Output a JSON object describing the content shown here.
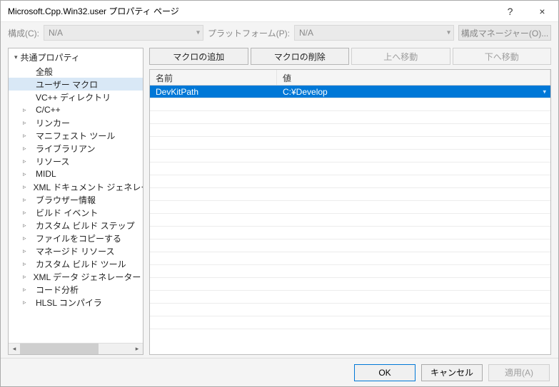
{
  "title": "Microsoft.Cpp.Win32.user プロパティ ページ",
  "titlebar": {
    "help": "?",
    "close": "×"
  },
  "config": {
    "cfg_label": "構成(C):",
    "cfg_value": "N/A",
    "plat_label": "プラットフォーム(P):",
    "plat_value": "N/A",
    "cfg_mgr": "構成マネージャー(O)..."
  },
  "tree": {
    "root": "共通プロパティ",
    "items": [
      {
        "label": "全般",
        "arrow": false,
        "selected": false
      },
      {
        "label": "ユーザー マクロ",
        "arrow": false,
        "selected": true
      },
      {
        "label": "VC++ ディレクトリ",
        "arrow": false,
        "selected": false
      },
      {
        "label": "C/C++",
        "arrow": true,
        "selected": false
      },
      {
        "label": "リンカー",
        "arrow": true,
        "selected": false
      },
      {
        "label": "マニフェスト ツール",
        "arrow": true,
        "selected": false
      },
      {
        "label": "ライブラリアン",
        "arrow": true,
        "selected": false
      },
      {
        "label": "リソース",
        "arrow": true,
        "selected": false
      },
      {
        "label": "MIDL",
        "arrow": true,
        "selected": false
      },
      {
        "label": "XML ドキュメント ジェネレーター",
        "arrow": true,
        "selected": false
      },
      {
        "label": "ブラウザー情報",
        "arrow": true,
        "selected": false
      },
      {
        "label": "ビルド イベント",
        "arrow": true,
        "selected": false
      },
      {
        "label": "カスタム ビルド ステップ",
        "arrow": true,
        "selected": false
      },
      {
        "label": "ファイルをコピーする",
        "arrow": true,
        "selected": false
      },
      {
        "label": "マネージド リソース",
        "arrow": true,
        "selected": false
      },
      {
        "label": "カスタム ビルド ツール",
        "arrow": true,
        "selected": false
      },
      {
        "label": "XML データ ジェネレーター ツ...",
        "arrow": true,
        "selected": false
      },
      {
        "label": "コード分析",
        "arrow": true,
        "selected": false
      },
      {
        "label": "HLSL コンパイラ",
        "arrow": true,
        "selected": false
      }
    ]
  },
  "buttons": {
    "add": "マクロの追加",
    "del": "マクロの削除",
    "up": "上へ移動",
    "down": "下へ移動"
  },
  "grid": {
    "col_name": "名前",
    "col_val": "値",
    "rows": [
      {
        "name": "DevKitPath",
        "value": "C:¥Develop",
        "selected": true
      }
    ]
  },
  "footer": {
    "ok": "OK",
    "cancel": "キャンセル",
    "apply": "適用(A)"
  }
}
